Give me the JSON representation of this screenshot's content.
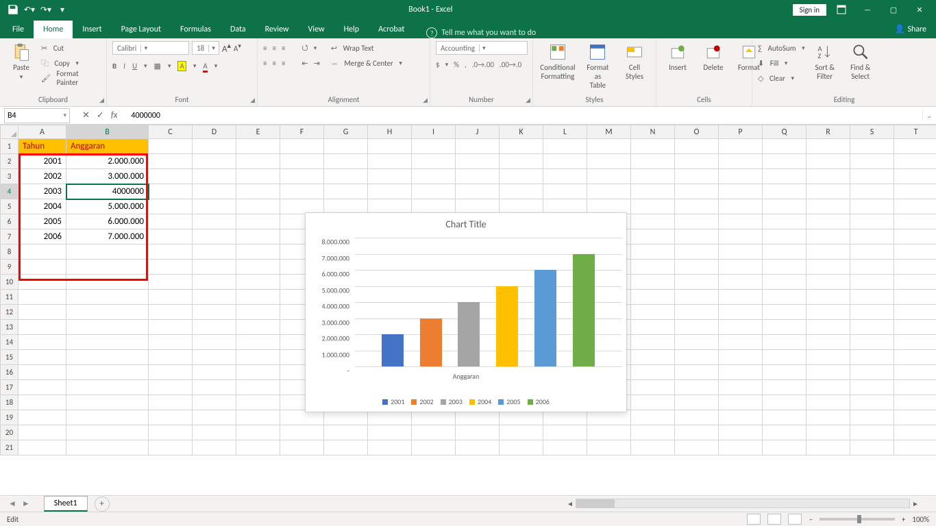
{
  "title": "Book1 - Excel",
  "signin": "Sign in",
  "tabs": {
    "file": "File",
    "home": "Home",
    "insert": "Insert",
    "pagelayout": "Page Layout",
    "formulas": "Formulas",
    "data": "Data",
    "review": "Review",
    "view": "View",
    "help": "Help",
    "acrobat": "Acrobat",
    "tellme": "Tell me what you want to do",
    "share": "Share"
  },
  "ribbon": {
    "clipboard": {
      "label": "Clipboard",
      "paste": "Paste",
      "cut": "Cut",
      "copy": "Copy",
      "fp": "Format Painter"
    },
    "font": {
      "label": "Font",
      "name": "Calibri",
      "size": "18"
    },
    "alignment": {
      "label": "Alignment",
      "wrap": "Wrap Text",
      "merge": "Merge & Center"
    },
    "number": {
      "label": "Number",
      "fmt": "Accounting"
    },
    "styles": {
      "label": "Styles",
      "cond": "Conditional\nFormatting",
      "fat": "Format as\nTable",
      "cell": "Cell\nStyles"
    },
    "cells": {
      "label": "Cells",
      "insert": "Insert",
      "delete": "Delete",
      "format": "Format"
    },
    "editing": {
      "label": "Editing",
      "autosum": "AutoSum",
      "fill": "Fill",
      "clear": "Clear",
      "sort": "Sort &\nFilter",
      "find": "Find &\nSelect"
    }
  },
  "namebox": "B4",
  "formula": "4000000",
  "columns": [
    "A",
    "B",
    "C",
    "D",
    "E",
    "F",
    "G",
    "H",
    "I",
    "J",
    "K",
    "L",
    "M",
    "N",
    "O",
    "P",
    "Q",
    "R",
    "S",
    "T"
  ],
  "headers": {
    "a": "Tahun",
    "b": "Anggaran"
  },
  "rows": [
    {
      "a": "2001",
      "b": "2.000.000"
    },
    {
      "a": "2002",
      "b": "3.000.000"
    },
    {
      "a": "2003",
      "b": "4000000"
    },
    {
      "a": "2004",
      "b": "5.000.000"
    },
    {
      "a": "2005",
      "b": "6.000.000"
    },
    {
      "a": "2006",
      "b": "7.000.000"
    }
  ],
  "sheet": "Sheet1",
  "status": {
    "mode": "Edit",
    "zoom": "100%"
  },
  "chart_data": {
    "type": "bar",
    "title": "Chart Title",
    "xlabel": "Anggaran",
    "ylabel": "",
    "ylim": [
      0,
      8000000
    ],
    "yticks": [
      "-",
      "1.000.000",
      "2.000.000",
      "3.000.000",
      "4.000.000",
      "5.000.000",
      "6.000.000",
      "7.000.000",
      "8.000.000"
    ],
    "categories": [
      "2001",
      "2002",
      "2003",
      "2004",
      "2005",
      "2006"
    ],
    "values": [
      2000000,
      3000000,
      4000000,
      5000000,
      6000000,
      7000000
    ],
    "colors": [
      "#4472c4",
      "#ed7d31",
      "#a5a5a5",
      "#ffc000",
      "#5b9bd5",
      "#70ad47"
    ]
  }
}
